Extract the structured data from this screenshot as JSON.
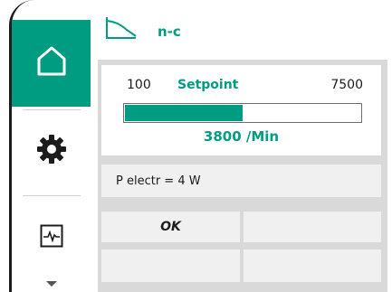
{
  "header": {
    "mode_icon": "curve-mode-icon",
    "mode_label": "n-c"
  },
  "sidebar": {
    "items": [
      {
        "name": "home",
        "icon": "home-icon",
        "active": true
      },
      {
        "name": "settings",
        "icon": "gear-icon",
        "active": false
      },
      {
        "name": "trend",
        "icon": "pulse-icon",
        "active": false
      },
      {
        "name": "more",
        "icon": "chevron-down-icon",
        "active": false
      }
    ]
  },
  "setpoint": {
    "min": "100",
    "title": "Setpoint",
    "max": "7500",
    "value": "3800 /Min",
    "fill_fraction": 0.5
  },
  "power": {
    "text": "P electr = 4 W"
  },
  "buttons": {
    "ok": "OK",
    "right_top": "",
    "left_bottom": "",
    "right_bottom": ""
  },
  "colors": {
    "accent": "#009c82",
    "panel": "#d9d9d9",
    "card": "#f0f0f0",
    "text": "#1c1c1c"
  }
}
